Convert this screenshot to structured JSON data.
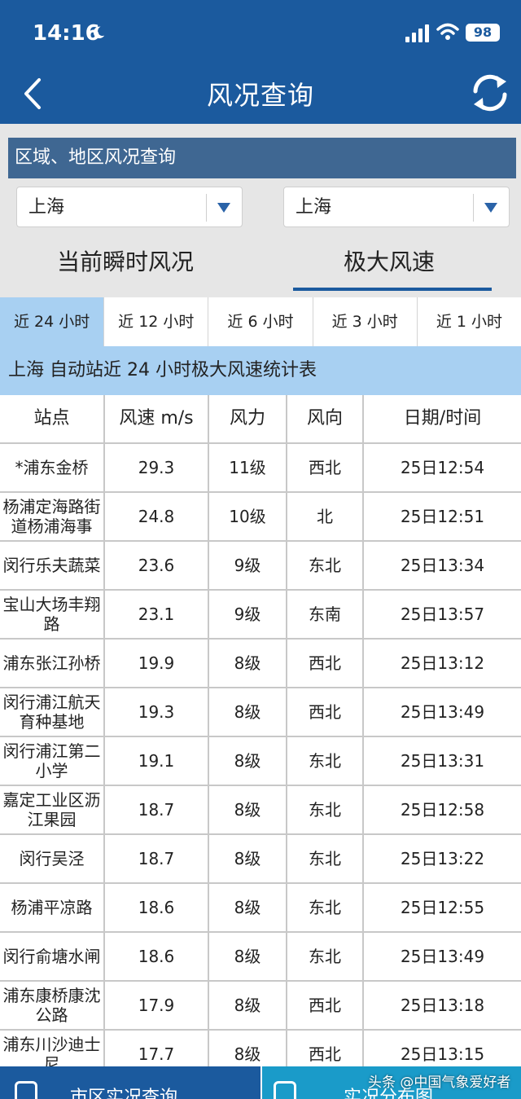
{
  "status_bar": {
    "time": "14:16",
    "battery": "98"
  },
  "header": {
    "title": "风况查询"
  },
  "region_section": {
    "title": "区域、地区风况查询",
    "select_left": "上海",
    "select_right": "上海"
  },
  "mode_tabs": [
    {
      "label": "当前瞬时风况",
      "active": false
    },
    {
      "label": "极大风速",
      "active": true
    }
  ],
  "period_tabs": [
    {
      "label": "近 24 小时",
      "active": true
    },
    {
      "label": "近 12 小时",
      "active": false
    },
    {
      "label": "近 6 小时",
      "active": false
    },
    {
      "label": "近 3 小时",
      "active": false
    },
    {
      "label": "近 1 小时",
      "active": false
    }
  ],
  "table": {
    "title": "上海 自动站近 24 小时极大风速统计表",
    "columns": [
      "站点",
      "风速 m/s",
      "风力",
      "风向",
      "日期/时间"
    ],
    "rows": [
      [
        "*浦东金桥",
        "29.3",
        "11级",
        "西北",
        "25日12:54"
      ],
      [
        "杨浦定海路街道杨浦海事",
        "24.8",
        "10级",
        "北",
        "25日12:51"
      ],
      [
        "闵行乐夫蔬菜",
        "23.6",
        "9级",
        "东北",
        "25日13:34"
      ],
      [
        "宝山大场丰翔路",
        "23.1",
        "9级",
        "东南",
        "25日13:57"
      ],
      [
        "浦东张江孙桥",
        "19.9",
        "8级",
        "西北",
        "25日13:12"
      ],
      [
        "闵行浦江航天育种基地",
        "19.3",
        "8级",
        "西北",
        "25日13:49"
      ],
      [
        "闵行浦江第二小学",
        "19.1",
        "8级",
        "东北",
        "25日13:31"
      ],
      [
        "嘉定工业区沥江果园",
        "18.7",
        "8级",
        "东北",
        "25日12:58"
      ],
      [
        "闵行吴泾",
        "18.7",
        "8级",
        "东北",
        "25日13:22"
      ],
      [
        "杨浦平凉路",
        "18.6",
        "8级",
        "东北",
        "25日12:55"
      ],
      [
        "闵行俞塘水闸",
        "18.6",
        "8级",
        "东北",
        "25日13:49"
      ],
      [
        "浦东康桥康沈公路",
        "17.9",
        "8级",
        "西北",
        "25日13:18"
      ],
      [
        "浦东川沙迪士尼",
        "17.7",
        "8级",
        "西北",
        "25日13:15"
      ]
    ]
  },
  "bottom_bar": {
    "left_label": "市区实况查询",
    "right_label": "实况分布图"
  },
  "watermark": "头条 @中国气象爱好者",
  "colors": {
    "primary": "#1b5a9e",
    "section_header": "#3f6792",
    "highlight": "#a8d0f2",
    "secondary_button": "#1a9bc9"
  }
}
